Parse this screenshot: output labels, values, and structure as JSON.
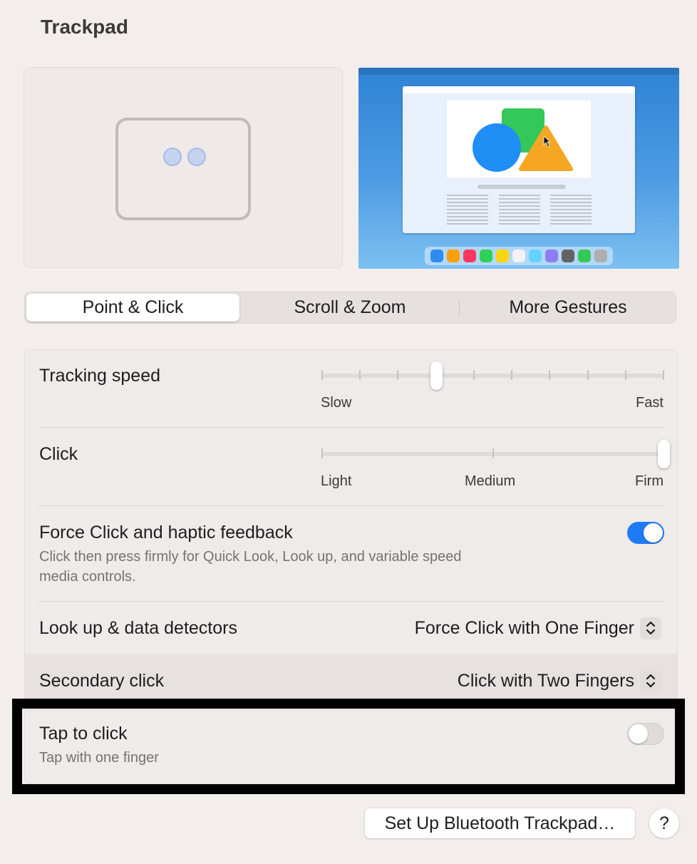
{
  "window": {
    "title": "Trackpad"
  },
  "preview": {
    "left_icon": "two-finger-trackpad-icon",
    "right_icon": "desktop-preview-illustration"
  },
  "tabs": [
    {
      "label": "Point & Click",
      "selected": true
    },
    {
      "label": "Scroll & Zoom",
      "selected": false
    },
    {
      "label": "More Gestures",
      "selected": false
    }
  ],
  "settings": {
    "tracking_speed": {
      "label": "Tracking speed",
      "min_label": "Slow",
      "max_label": "Fast",
      "ticks": 10,
      "value_step": 3
    },
    "click": {
      "label": "Click",
      "labels": [
        "Light",
        "Medium",
        "Firm"
      ],
      "ticks": 3,
      "value_step": 2
    },
    "force_click": {
      "label": "Force Click and haptic feedback",
      "description_line1": "Click then press firmly for Quick Look, Look up, and variable speed",
      "description_line2": "media controls.",
      "enabled": true
    },
    "lookup": {
      "label": "Look up & data detectors",
      "value": "Force Click with One Finger"
    },
    "secondary_click": {
      "label": "Secondary click",
      "value": "Click with Two Fingers"
    },
    "tap_to_click": {
      "label": "Tap to click",
      "description": "Tap with one finger",
      "enabled": false
    }
  },
  "buttons": {
    "bluetooth": "Set Up Bluetooth Trackpad…",
    "help": "?"
  },
  "colors": {
    "accent": "#1f7bf5",
    "background": "#f3eeec",
    "highlight_border": "#000000"
  }
}
